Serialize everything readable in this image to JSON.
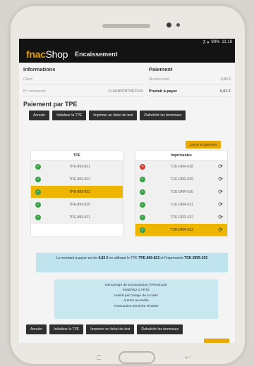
{
  "status": {
    "icons": "⊼ ▾",
    "battery": "99%",
    "time": "11:18"
  },
  "app": {
    "brand_fnac": "fnac",
    "brand_shop": "Shop",
    "title": "Encaissement"
  },
  "info": {
    "title": "Informations",
    "client_label": "Client",
    "order_label": "N° commande",
    "order_value": "CLANNNTBTHE2XXX"
  },
  "amounts": {
    "title": "Paiement",
    "total_label": "Montant total",
    "total_value": "6,83 €",
    "due_label": "Produit à payer",
    "due_value": "6,83 €"
  },
  "payment": {
    "title": "Paiement par TPE",
    "buttons": [
      "Annuler",
      "Initialiser la TPE",
      "Imprimer un ticket de test",
      "Rafraîchir les terminaux"
    ],
    "launch_label": "Lancer le paiement"
  },
  "tpe": {
    "header": "TPE",
    "rows": [
      {
        "label": "TPE-899-821",
        "status": "ok",
        "selected": false
      },
      {
        "label": "TPE-899-822",
        "status": "ok",
        "selected": false
      },
      {
        "label": "TPE-899-823",
        "status": "ok",
        "selected": true
      },
      {
        "label": "TPE-899-820",
        "status": "ok",
        "selected": false
      },
      {
        "label": "TPE-899-821",
        "status": "ok",
        "selected": false
      }
    ]
  },
  "printers": {
    "header": "Imprimantes",
    "rows": [
      {
        "label": "TCK-DRR-028",
        "status": "err",
        "selected": false
      },
      {
        "label": "TCK-DRR-029",
        "status": "ok",
        "selected": false
      },
      {
        "label": "TCK-DRR-030",
        "status": "ok",
        "selected": false
      },
      {
        "label": "TCK-DRR-031",
        "status": "ok",
        "selected": false
      },
      {
        "label": "TCK-DRR-032",
        "status": "ok",
        "selected": false
      },
      {
        "label": "TCK-DRR-033",
        "status": "ok",
        "selected": true
      }
    ]
  },
  "message": {
    "prefix": "Le montant à payer est de",
    "amount": "6,83 €",
    "mid": "en utilisant le TPE",
    "tpe": "TPE-899-823",
    "mid2": "et l'imprimante",
    "printer": "TCK-DRR-033"
  },
  "log": {
    "lines": [
      "Démarrage de la transaction (TPE00120)",
      "INSEREZ CARTE",
      "Inséré par l'usage de la carte",
      "Autoris accordée",
      "Transaction terminée réussite"
    ]
  },
  "bottom_buttons": [
    "Annuler",
    "Initialiser la TPE",
    "Imprimer un ticket de test",
    "Rafraîchir les terminaux"
  ],
  "device": {
    "back": "↩",
    "recent": "⊏"
  }
}
